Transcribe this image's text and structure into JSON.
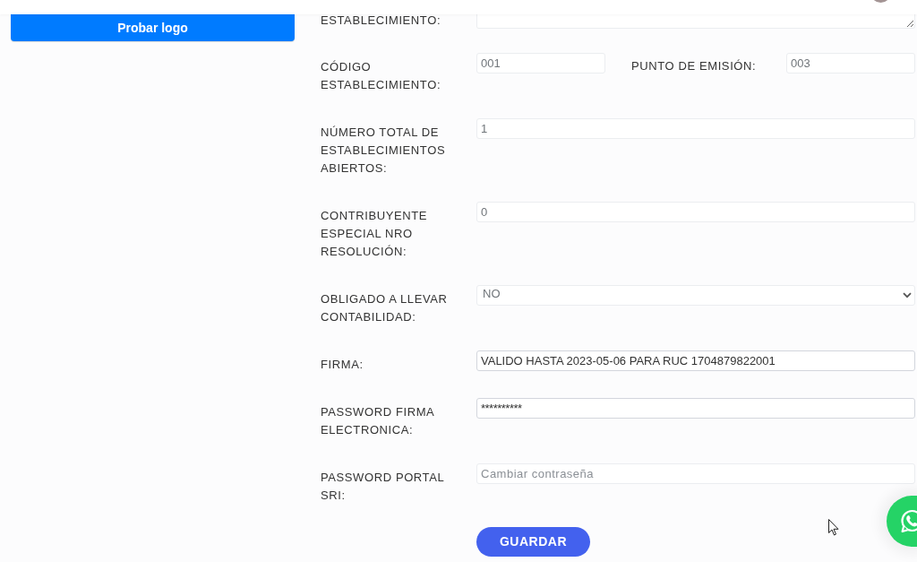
{
  "sidebar": {
    "logo_button": "Probar logo"
  },
  "form": {
    "fields": [
      {
        "kind": "textarea",
        "label": "ESTABLECIMIENTO:"
      },
      {
        "kind": "pair",
        "label": "CÓDIGO ESTABLECIMIENTO:",
        "value": "001",
        "disabled": true,
        "second_label": "PUNTO DE EMISIÓN:",
        "second_value": "003",
        "second_disabled": true
      },
      {
        "kind": "text",
        "label": "NÚMERO TOTAL DE ESTABLECIMIENTOS ABIERTOS:",
        "value": "1",
        "disabled": true
      },
      {
        "kind": "text",
        "label": "CONTRIBUYENTE ESPECIAL NRO RESOLUCIÓN:",
        "value": "0",
        "disabled": true
      },
      {
        "kind": "select",
        "label": "OBLIGADO A LLEVAR CONTABILIDAD:",
        "value": "NO",
        "disabled": true
      },
      {
        "kind": "text",
        "label": "FIRMA:",
        "value": "VALIDO HASTA 2023-05-06 PARA RUC 1704879822001",
        "disabled": false
      },
      {
        "kind": "password",
        "label": "PASSWORD FIRMA ELECTRONICA:",
        "value": "**********",
        "disabled": false
      },
      {
        "kind": "text",
        "label": "PASSWORD PORTAL SRI:",
        "placeholder": "Cambiar contraseña"
      }
    ],
    "submit_button": "GUARDAR"
  }
}
